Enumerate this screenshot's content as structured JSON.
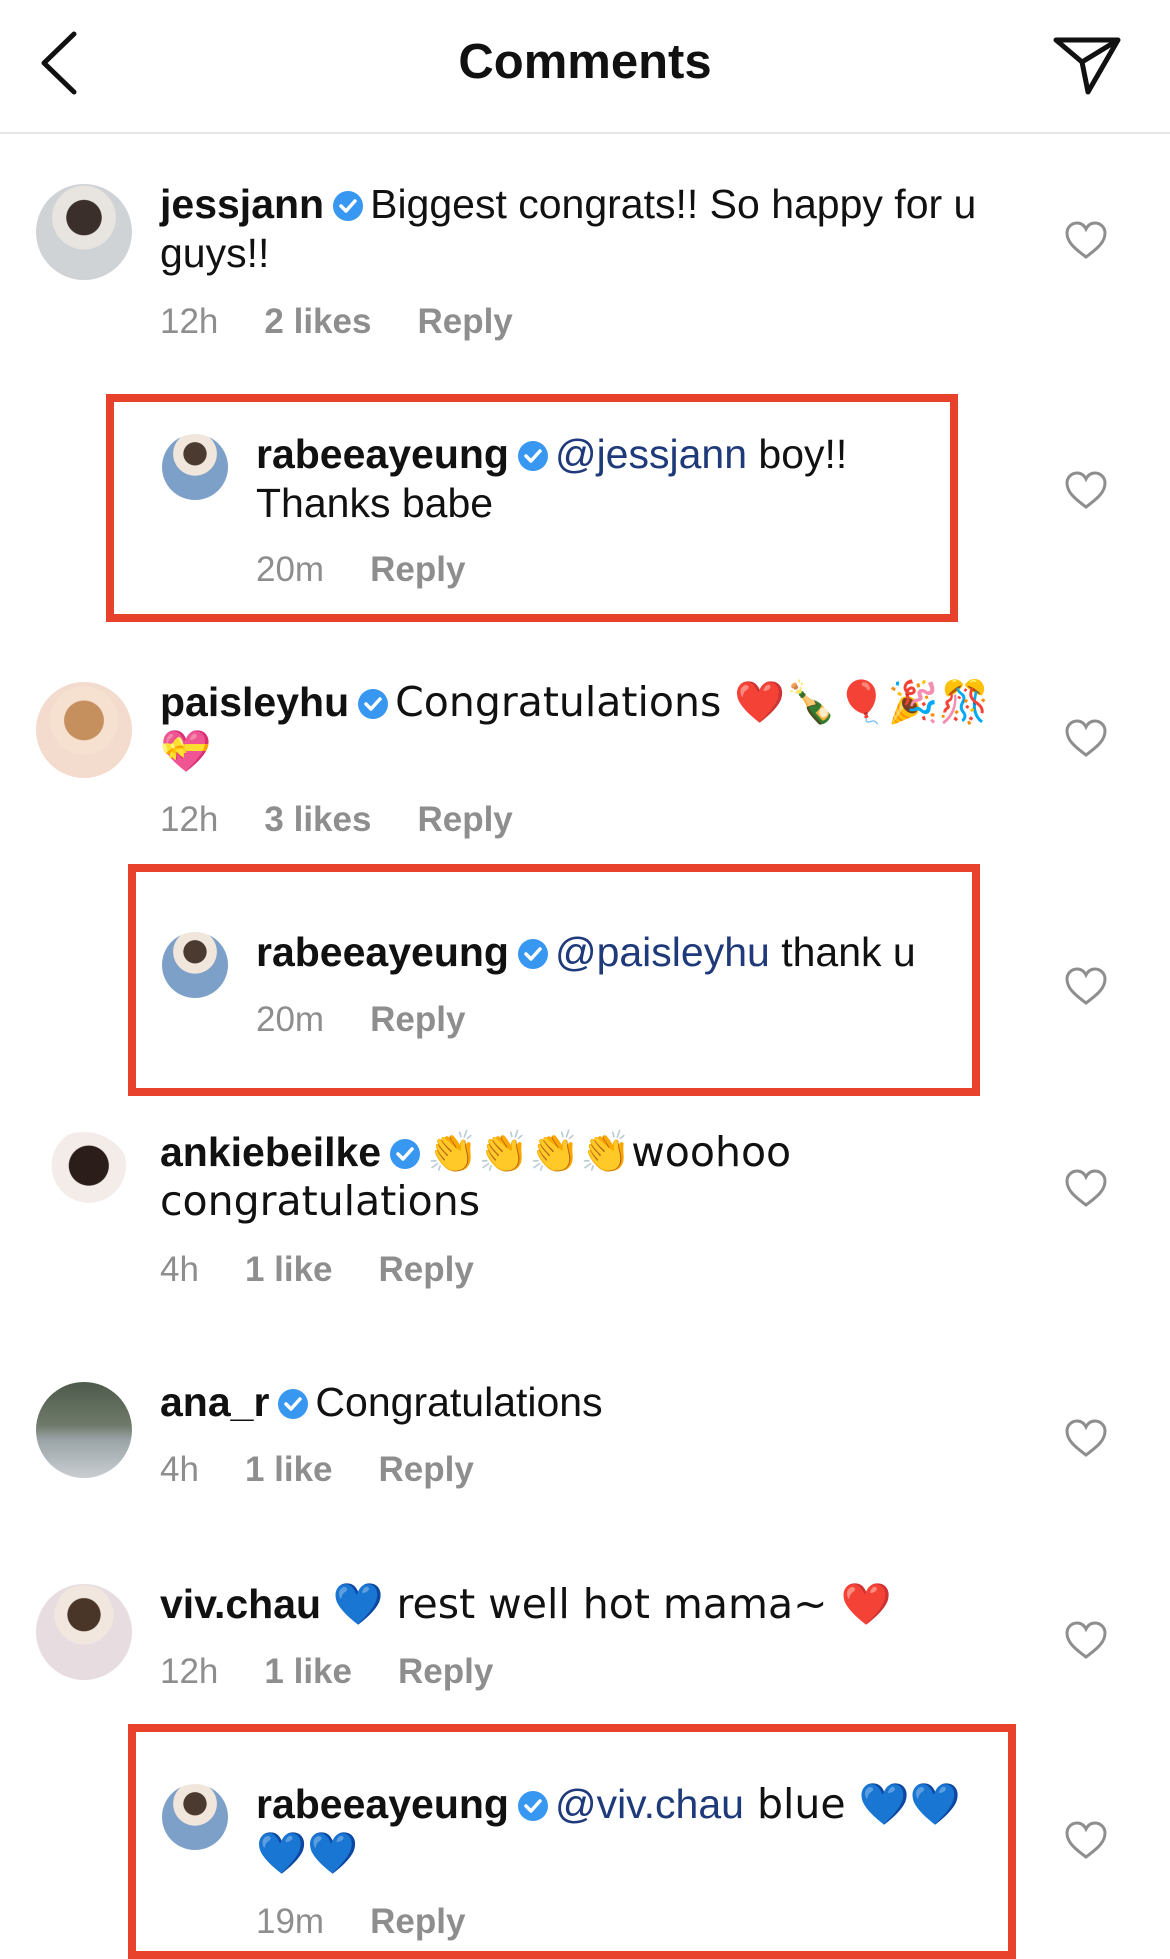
{
  "header": {
    "title": "Comments",
    "back_icon": "chevron-left-icon",
    "send_icon": "send-icon"
  },
  "comments": [
    {
      "username": "jessjann",
      "text": "Biggest congrats!! So happy for u guys!!",
      "time": "12h",
      "likes": "2 likes",
      "reply": "Reply"
    },
    {
      "username": "rabeeayeung",
      "mention": "@jessjann",
      "text": " boy!! Thanks babe",
      "time": "20m",
      "reply": "Reply"
    },
    {
      "username": "paisleyhu",
      "text": "Congratulations ❤️🍾🎈🎉🎊💝",
      "time": "12h",
      "likes": "3 likes",
      "reply": "Reply"
    },
    {
      "username": "rabeeayeung",
      "mention": "@paisleyhu",
      "text": " thank u",
      "time": "20m",
      "reply": "Reply"
    },
    {
      "username": "ankiebeilke",
      "text": "👏👏👏👏woohoo congratulations",
      "time": "4h",
      "likes": "1 like",
      "reply": "Reply"
    },
    {
      "username": "ana_r",
      "text": "Congratulations",
      "time": "4h",
      "likes": "1 like",
      "reply": "Reply"
    },
    {
      "username": "viv.chau",
      "text": "💙 rest well hot mama~ ❤️",
      "time": "12h",
      "likes": "1 like",
      "reply": "Reply"
    },
    {
      "username": "rabeeayeung",
      "mention": "@viv.chau",
      "text": " blue 💙💙💙💙",
      "time": "19m",
      "reply": "Reply"
    }
  ],
  "colors": {
    "highlight": "#e8412c",
    "verified": "#3897f0",
    "mention": "#1f3a7a",
    "meta": "#8e8e8e"
  }
}
